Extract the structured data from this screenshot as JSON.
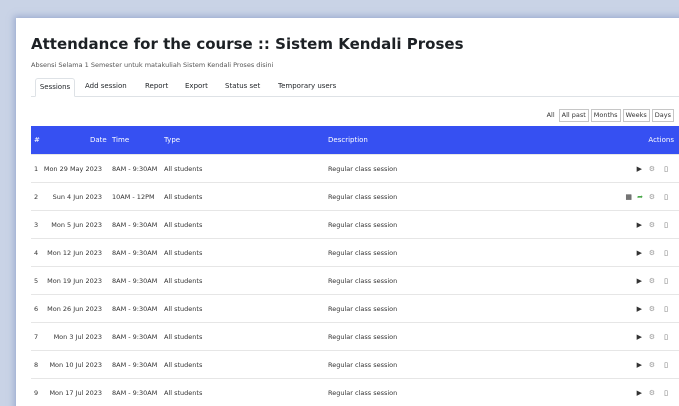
{
  "page": {
    "title": "Attendance for the course :: Sistem Kendali Proses",
    "subtitle": "Absensi Selama 1 Semester untuk matakuliah Sistem Kendali Proses disini"
  },
  "tabs": [
    {
      "label": "Sessions",
      "active": true
    },
    {
      "label": "Add session",
      "active": false
    },
    {
      "label": "Report",
      "active": false
    },
    {
      "label": "Export",
      "active": false
    },
    {
      "label": "Status set",
      "active": false
    },
    {
      "label": "Temporary users",
      "active": false
    }
  ],
  "views": {
    "all_label": "All",
    "buttons": [
      "All past",
      "Months",
      "Weeks",
      "Days"
    ]
  },
  "table": {
    "headers": {
      "num": "#",
      "date": "Date",
      "time": "Time",
      "type": "Type",
      "description": "Description",
      "actions": "Actions"
    },
    "rows": [
      {
        "num": "1",
        "date": "Mon 29 May 2023",
        "time": "8AM - 9:30AM",
        "type": "All students",
        "description": "Regular class session",
        "actions": [
          "play-icon",
          "gear-icon",
          "trash-icon"
        ]
      },
      {
        "num": "2",
        "date": "Sun 4 Jun 2023",
        "time": "10AM - 12PM",
        "type": "All students",
        "description": "Regular class session",
        "actions": [
          "qrcode-icon",
          "go-icon",
          "gear-icon",
          "trash-icon"
        ]
      },
      {
        "num": "3",
        "date": "Mon 5 Jun 2023",
        "time": "8AM - 9:30AM",
        "type": "All students",
        "description": "Regular class session",
        "actions": [
          "play-icon",
          "gear-icon",
          "trash-icon"
        ]
      },
      {
        "num": "4",
        "date": "Mon 12 Jun 2023",
        "time": "8AM - 9:30AM",
        "type": "All students",
        "description": "Regular class session",
        "actions": [
          "play-icon",
          "gear-icon",
          "trash-icon"
        ]
      },
      {
        "num": "5",
        "date": "Mon 19 Jun 2023",
        "time": "8AM - 9:30AM",
        "type": "All students",
        "description": "Regular class session",
        "actions": [
          "play-icon",
          "gear-icon",
          "trash-icon"
        ]
      },
      {
        "num": "6",
        "date": "Mon 26 Jun 2023",
        "time": "8AM - 9:30AM",
        "type": "All students",
        "description": "Regular class session",
        "actions": [
          "play-icon",
          "gear-icon",
          "trash-icon"
        ]
      },
      {
        "num": "7",
        "date": "Mon 3 Jul 2023",
        "time": "8AM - 9:30AM",
        "type": "All students",
        "description": "Regular class session",
        "actions": [
          "play-icon",
          "gear-icon",
          "trash-icon"
        ]
      },
      {
        "num": "8",
        "date": "Mon 10 Jul 2023",
        "time": "8AM - 9:30AM",
        "type": "All students",
        "description": "Regular class session",
        "actions": [
          "play-icon",
          "gear-icon",
          "trash-icon"
        ]
      },
      {
        "num": "9",
        "date": "Mon 17 Jul 2023",
        "time": "8AM - 9:30AM",
        "type": "All students",
        "description": "Regular class session",
        "actions": [
          "play-icon",
          "gear-icon",
          "trash-icon"
        ]
      }
    ]
  },
  "colors": {
    "header_bg": "#3650f2",
    "go_icon": "#4aa84a"
  }
}
